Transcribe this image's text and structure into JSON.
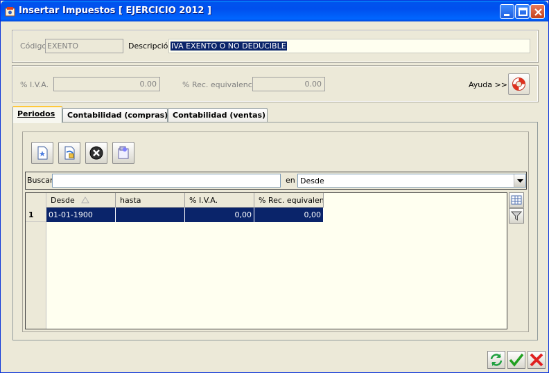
{
  "window": {
    "title": "Insertar Impuestos [ EJERCICIO 2012 ]"
  },
  "header": {
    "codigo_label": "Código",
    "codigo_value": "EXENTO",
    "descripcion_label": "Descripción",
    "descripcion_value": "IVA EXENTO O NO DEDUCIBLE"
  },
  "rates": {
    "iva_label": "% I.V.A.",
    "iva_value": "0.00",
    "rec_label": "% Rec. equivalencia",
    "rec_value": "0.00",
    "help_label": "Ayuda >>"
  },
  "tabs": [
    {
      "label": "Periodos",
      "active": true
    },
    {
      "label": "Contabilidad (compras)",
      "active": false
    },
    {
      "label": "Contabilidad (ventas)",
      "active": false
    }
  ],
  "search": {
    "label": "Buscar",
    "value": "",
    "en_label": "en",
    "field_selected": "Desde"
  },
  "grid": {
    "columns": [
      "Desde",
      "hasta",
      "% I.V.A.",
      "% Rec. equivalencia"
    ],
    "rows": [
      {
        "num": "1",
        "desde": "01-01-1900",
        "hasta": "",
        "iva": "0,00",
        "rec": "0,00"
      }
    ]
  },
  "colors": {
    "titlebar": "#0053ee",
    "selection": "#0a246a",
    "tab_highlight": "#ffc83c",
    "window_bg": "#ece9d8"
  }
}
